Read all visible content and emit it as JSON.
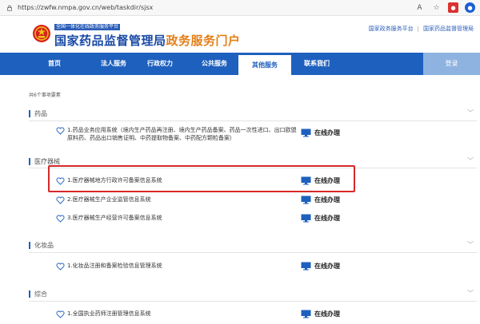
{
  "browser": {
    "url": "https://zwfw.nmpa.gov.cn/web/taskdir/sjsx"
  },
  "header": {
    "slogan": "全国一体化在线政务服务平台",
    "title_main": "国家药品监督管理局",
    "title_accent": "政务服务门户",
    "links": [
      "国家政务服务平台",
      "国家药品监督管理局"
    ]
  },
  "nav": {
    "items": [
      "首页",
      "法人服务",
      "行政权力",
      "公共服务",
      "其他服务",
      "联系我们"
    ],
    "active": "其他服务",
    "login": "登录"
  },
  "content": {
    "count": "共6个事项要素",
    "online_label": "在线办理",
    "sections": [
      {
        "title": "药品",
        "items": [
          "1.药品业务应用系统（境内生产药品再注册、境内生产药品备案、药品一次性进口、出口欧盟原料药、药品出口销售证明、中药提取物备案、中药配方颗粒备案）"
        ]
      },
      {
        "title": "医疗器械",
        "items": [
          "1.医疗器械地方行政许可备案信息系统",
          "2.医疗器械生产企业监管信息系统",
          "3.医疗器械生产经营许可备案信息系统"
        ]
      },
      {
        "title": "化妆品",
        "items": [
          "1.化妆品注册和备案检验信息管理系统"
        ]
      },
      {
        "title": "综合",
        "items": [
          "1.全国执业药师注册管理信息系统"
        ]
      }
    ]
  },
  "colors": {
    "nav_bg": "#1e60be",
    "accent_orange": "#e47f16",
    "highlight_red": "#d62828"
  }
}
